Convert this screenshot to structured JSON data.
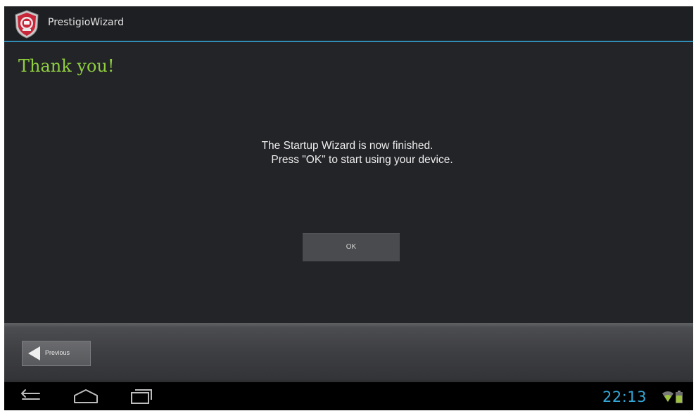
{
  "app": {
    "title": "PrestigioWizard",
    "icon": "prestigio-logo-icon"
  },
  "page": {
    "heading": "Thank you!",
    "message_line1": "The Startup Wizard is now finished.",
    "message_line2": "Press \"OK\" to start using your device."
  },
  "buttons": {
    "ok_label": "OK",
    "previous_label": "Previous"
  },
  "system_bar": {
    "time": "22:13",
    "nav_icons": [
      "back-icon",
      "home-icon",
      "recent-apps-icon"
    ],
    "status_icons": [
      "wifi-icon",
      "battery-icon"
    ]
  },
  "colors": {
    "heading": "#8fcf3f",
    "accent_line": "#2f8db8",
    "clock": "#33a7d8",
    "background": "#232428"
  }
}
